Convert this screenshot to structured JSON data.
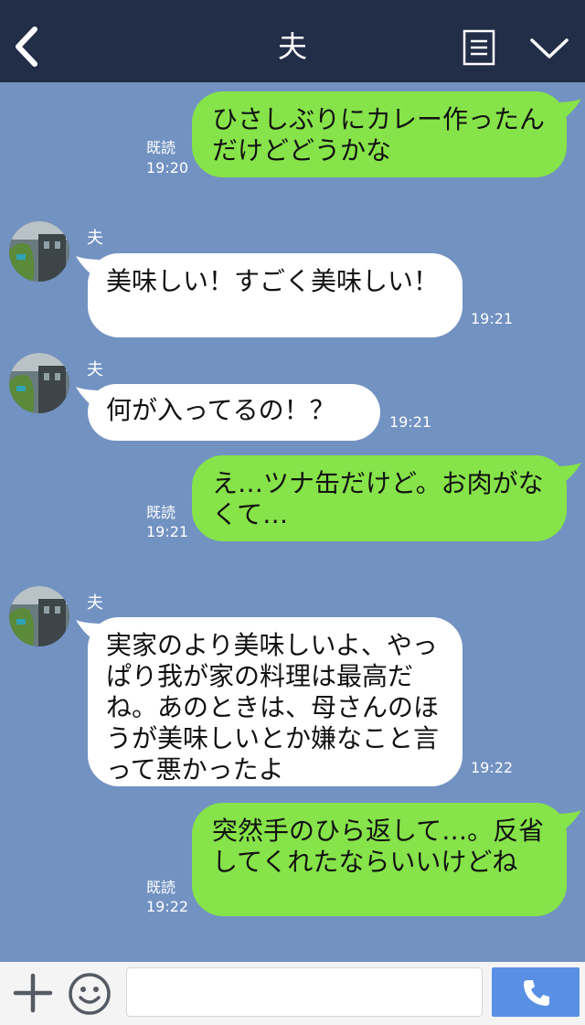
{
  "header": {
    "title": "夫"
  },
  "messages": [
    {
      "type": "out",
      "text": "ひさしぶりにカレー作ったんだけどどうかな",
      "read": "既読",
      "time": "19:20"
    },
    {
      "type": "in",
      "sender": "夫",
      "text": "美味しい！すごく美味しい！",
      "time": "19:21"
    },
    {
      "type": "in",
      "sender": "夫",
      "text": "何が入ってるの！？",
      "time": "19:21"
    },
    {
      "type": "out",
      "text": "え…ツナ缶だけど。お肉がなくて…",
      "read": "既読",
      "time": "19:21"
    },
    {
      "type": "in",
      "sender": "夫",
      "text": "実家のより美味しいよ、やっぱり我が家の料理は最高だね。あのときは、母さんのほうが美味しいとか嫌なこと言って悪かったよ",
      "time": "19:22"
    },
    {
      "type": "out",
      "text": "突然手のひら返して…。反省してくれたならいいけどね",
      "read": "既読",
      "time": "19:22"
    }
  ],
  "footer": {
    "input_value": ""
  },
  "colors": {
    "header_bg": "#222d48",
    "chat_bg": "#7292c2",
    "out_bubble": "#86e349",
    "in_bubble": "#ffffff",
    "send_button": "#5a8fe6"
  },
  "icons": {
    "back": "chevron-left-icon",
    "menu": "list-icon",
    "more": "chevron-down-icon",
    "add": "plus-icon",
    "emoji": "smiley-icon",
    "send": "phone-icon"
  }
}
